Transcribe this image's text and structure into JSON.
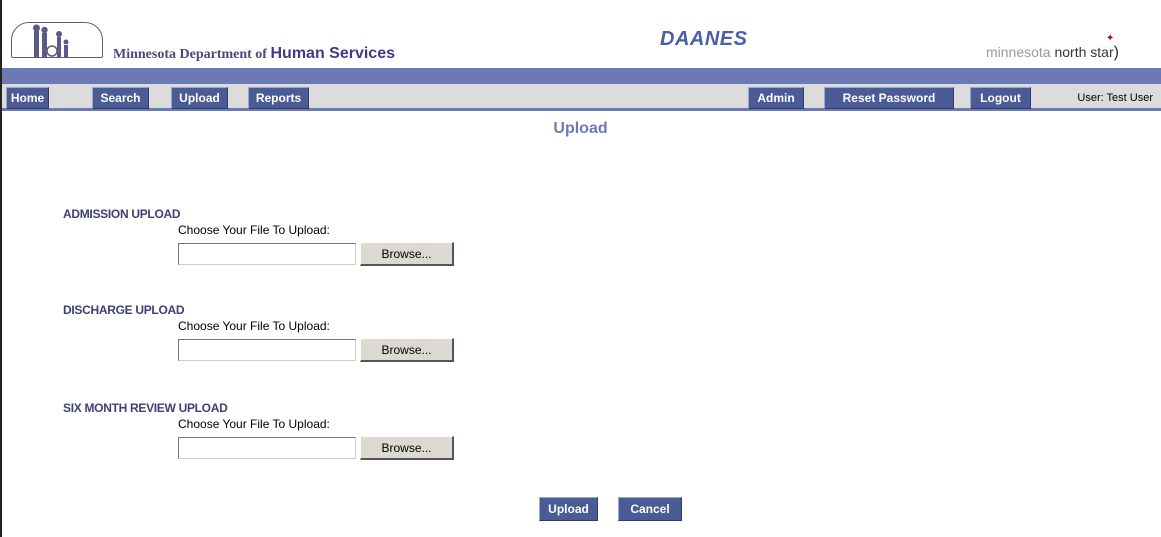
{
  "header": {
    "agency_prefix": "Minnesota Department of ",
    "agency_emphasis": "Human Services",
    "app_title": "DAANES",
    "brand_prefix": "minnesota ",
    "brand_emphasis": "north star"
  },
  "nav": {
    "left": [
      "Home",
      "Search",
      "Upload",
      "Reports"
    ],
    "right": [
      "Admin",
      "Reset Password",
      "Logout"
    ],
    "user": "User: Test User"
  },
  "page": {
    "title": "Upload"
  },
  "sections": [
    {
      "label": "ADMISSION UPLOAD",
      "choose": "Choose Your File To Upload:",
      "value": "",
      "browse": "Browse..."
    },
    {
      "label": "DISCHARGE UPLOAD",
      "choose": "Choose Your File To Upload:",
      "value": "",
      "browse": "Browse..."
    },
    {
      "label": "SIX MONTH REVIEW UPLOAD",
      "choose": "Choose Your File To Upload:",
      "value": "",
      "browse": "Browse..."
    }
  ],
  "actions": {
    "upload": "Upload",
    "cancel": "Cancel"
  },
  "colors": {
    "nav_band": "#6b7ab5",
    "nav_button": "#4b5b95",
    "title": "#6b7ab5",
    "section_label": "#3c4177"
  }
}
